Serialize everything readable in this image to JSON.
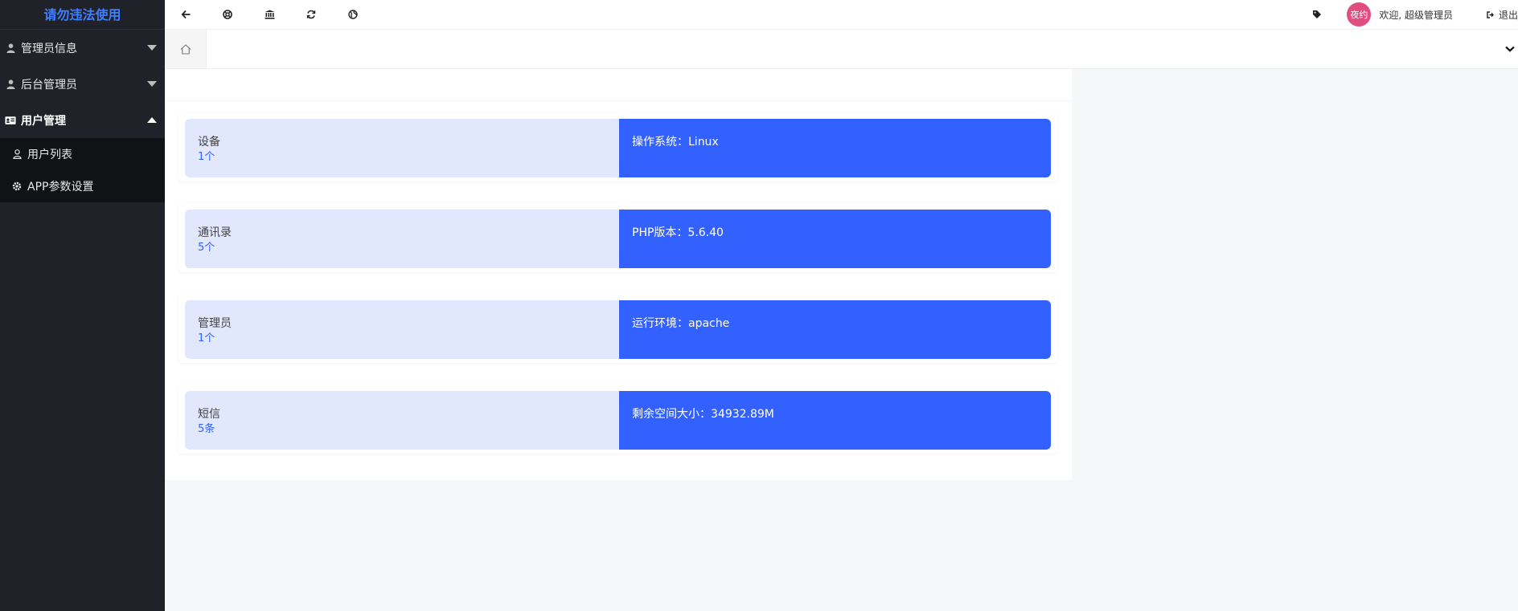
{
  "sidebar": {
    "logo": "请勿违法使用",
    "menu": [
      {
        "label": "管理员信息",
        "icon": "user-icon",
        "expanded": false
      },
      {
        "label": "后台管理员",
        "icon": "user-icon",
        "expanded": false
      },
      {
        "label": "用户管理",
        "icon": "id-card-icon",
        "expanded": true
      }
    ],
    "submenu": [
      {
        "label": "用户列表",
        "icon": "user-outline-icon"
      },
      {
        "label": "APP参数设置",
        "icon": "gear-icon"
      }
    ]
  },
  "topbar": {
    "tools": [
      {
        "icon": "arrow-left-icon"
      },
      {
        "icon": "lifebuoy-icon"
      },
      {
        "icon": "bank-icon"
      },
      {
        "icon": "refresh-icon"
      },
      {
        "icon": "globe-icon"
      }
    ],
    "avatar_text": "夜约",
    "welcome": "欢迎, 超级管理员",
    "logout": "退出"
  },
  "cards": [
    {
      "title": "设备",
      "count": "1个",
      "info": "操作系统：Linux"
    },
    {
      "title": "通讯录",
      "count": "5个",
      "info": "PHP版本：5.6.40"
    },
    {
      "title": "管理员",
      "count": "1个",
      "info": "运行环境：apache"
    },
    {
      "title": "短信",
      "count": "5条",
      "info": "剩余空间大小：34932.89M"
    }
  ],
  "colors": {
    "accent": "#3361ff",
    "card_left_bg": "#e1e7fc",
    "sidebar_bg": "#20222a",
    "submenu_bg": "#111216",
    "logo": "#3f7ffe",
    "avatar": "#e04d7f"
  }
}
